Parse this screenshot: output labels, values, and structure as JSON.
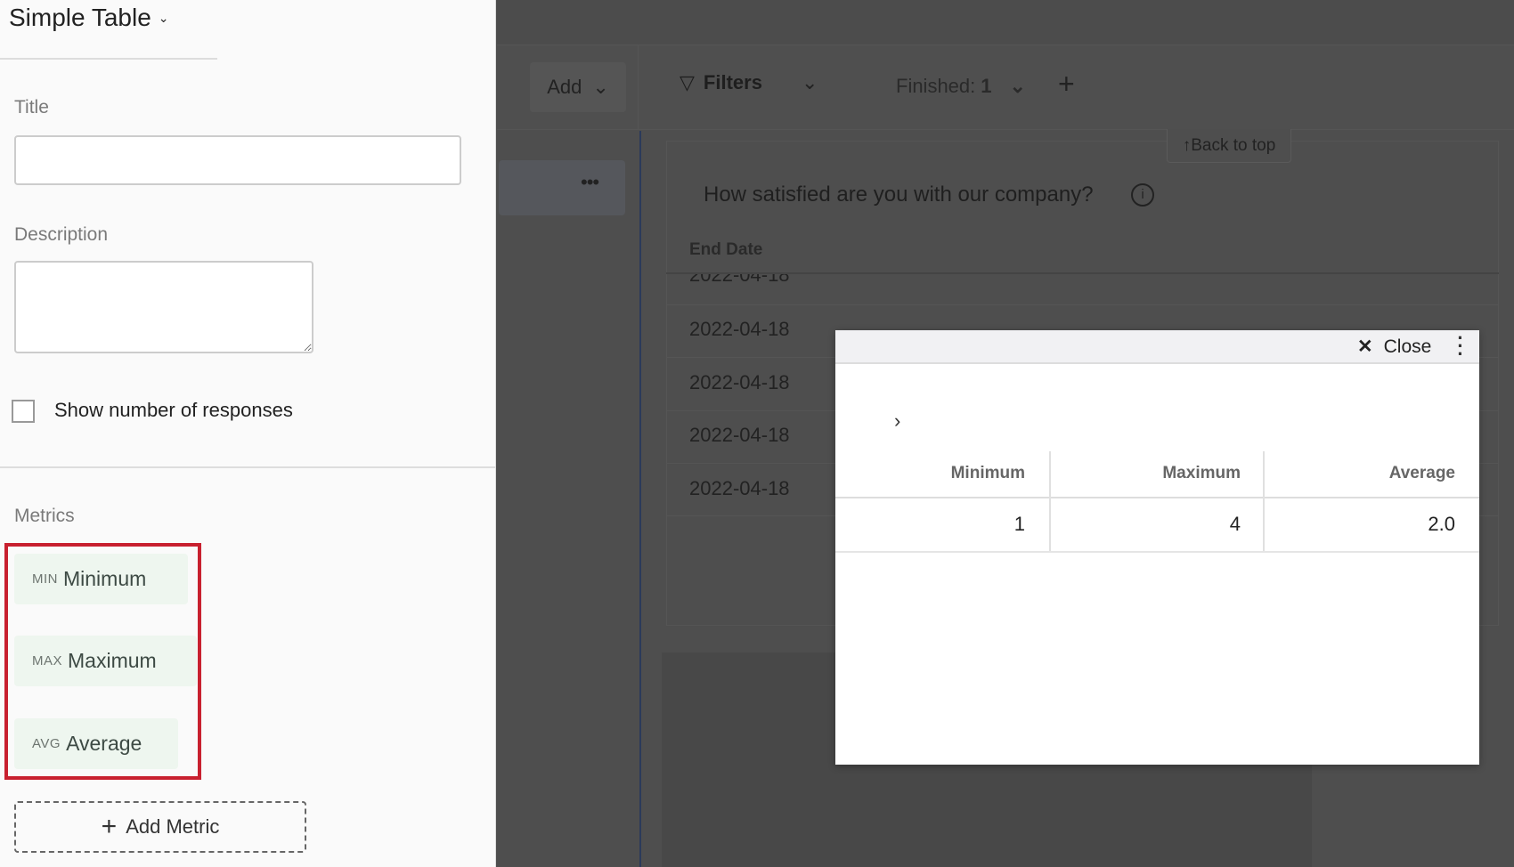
{
  "panel": {
    "widget_type": "Simple Table",
    "title_label": "Title",
    "title_value": "",
    "description_label": "Description",
    "description_value": "",
    "show_responses_label": "Show number of responses",
    "metrics_label": "Metrics",
    "metrics": [
      {
        "abbr": "MIN",
        "label": "Minimum"
      },
      {
        "abbr": "MAX",
        "label": "Maximum"
      },
      {
        "abbr": "AVG",
        "label": "Average"
      }
    ],
    "add_metric_label": "Add Metric",
    "highlight_color": "#c8202f"
  },
  "toolbar": {
    "add_label": "Add",
    "filters_label": "Filters",
    "finished_label": "Finished:",
    "finished_value": "1"
  },
  "report": {
    "back_to_top": "Back to top",
    "question": "How satisfied are you with our company?",
    "column_header": "End Date",
    "rows": [
      "2022-04-18",
      "2022-04-18",
      "2022-04-18",
      "2022-04-18",
      "2022-04-18"
    ]
  },
  "modal": {
    "close_label": "Close",
    "headers": [
      "Minimum",
      "Maximum",
      "Average"
    ],
    "values": [
      "1",
      "4",
      "2.0"
    ]
  }
}
